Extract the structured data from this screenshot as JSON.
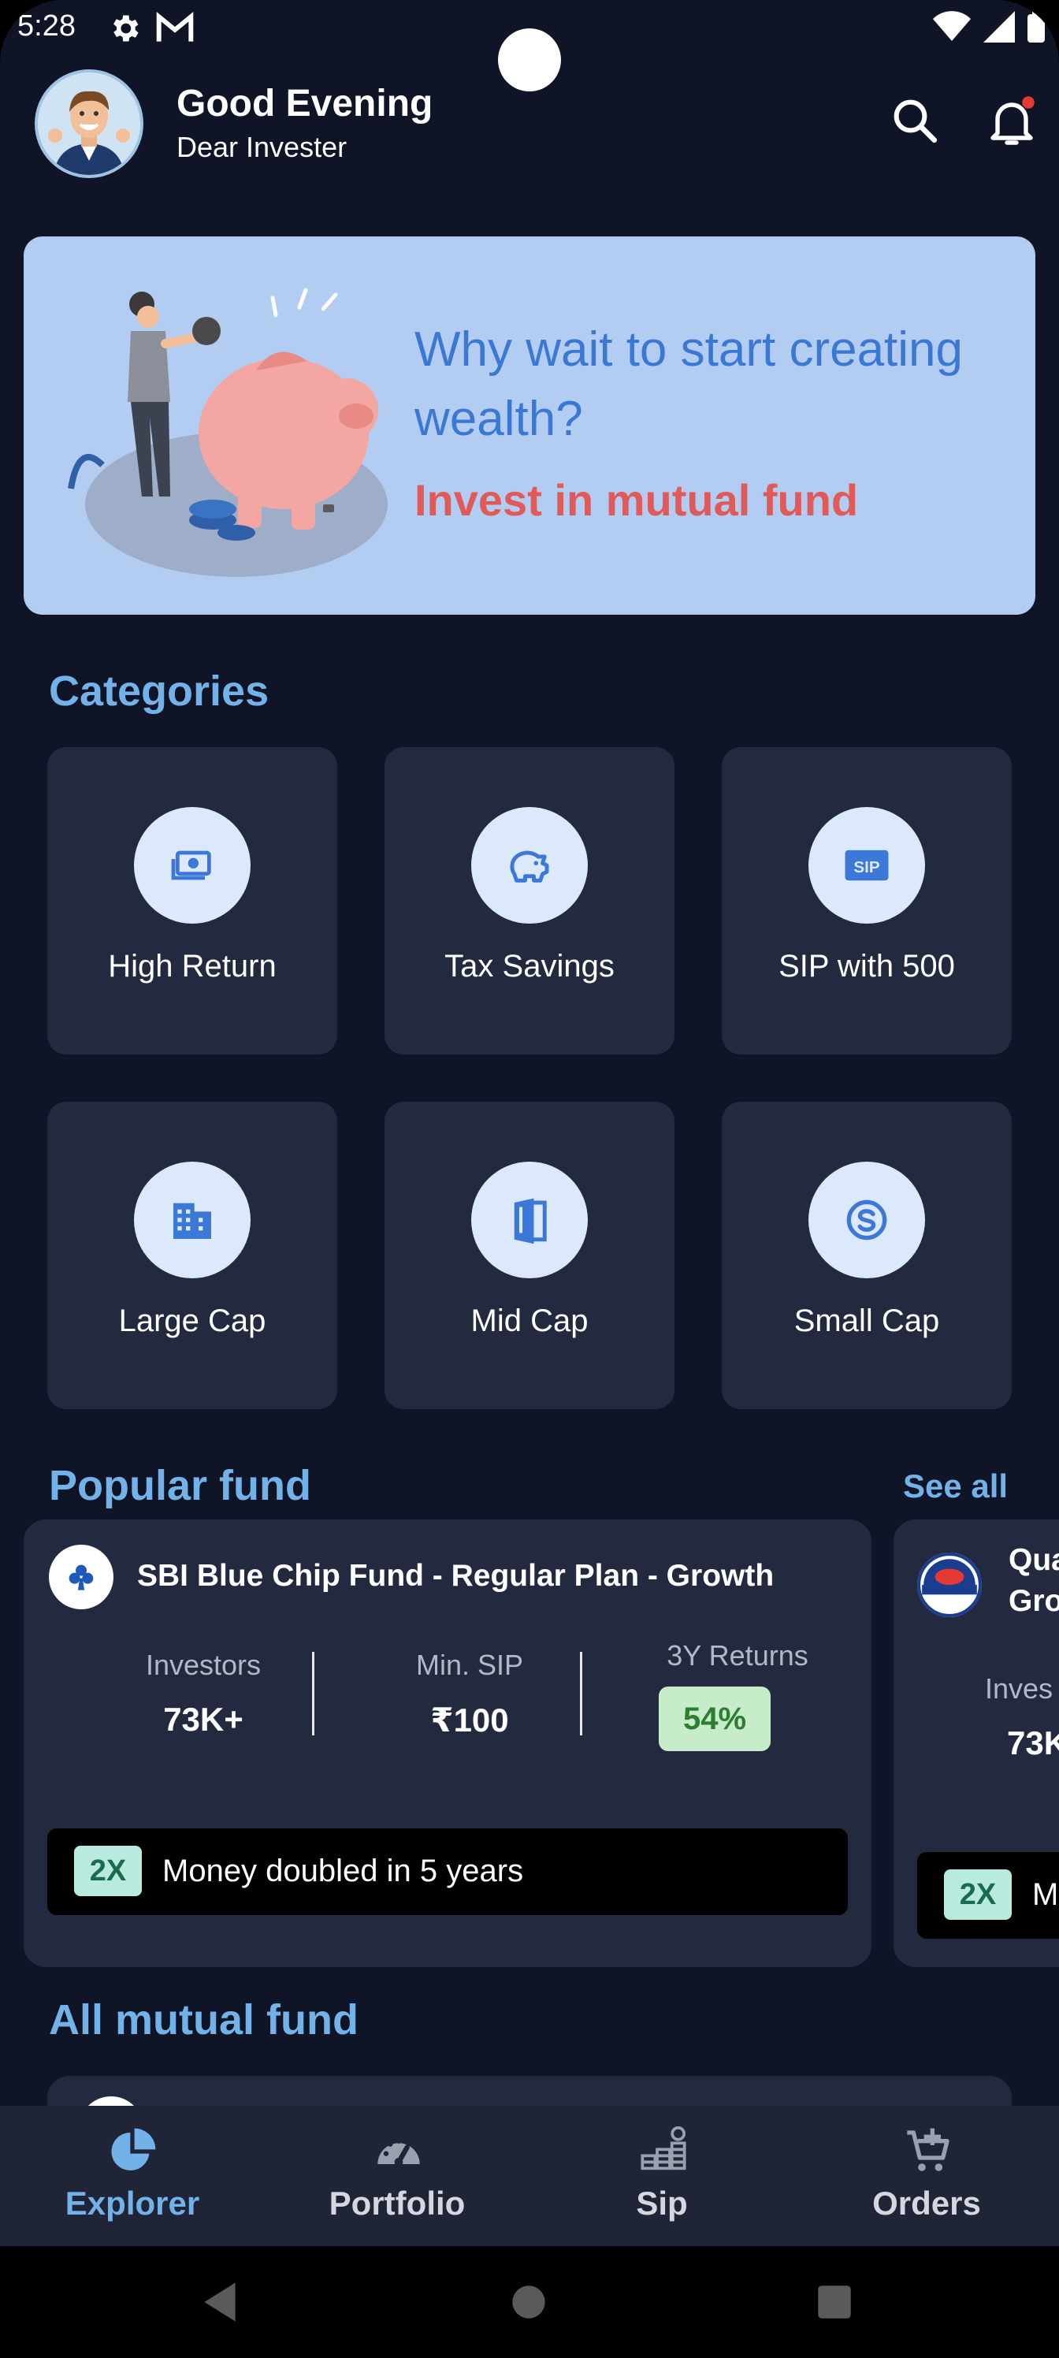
{
  "status_bar": {
    "time": "5:28"
  },
  "header": {
    "greeting": "Good Evening",
    "subgreeting": "Dear Invester"
  },
  "banner": {
    "title": "Why wait to start creating wealth?",
    "subtitle": "Invest in mutual fund"
  },
  "categories": {
    "title": "Categories",
    "items": [
      {
        "label": "High Return",
        "icon": "money-icon"
      },
      {
        "label": "Tax Savings",
        "icon": "piggy-bank-icon"
      },
      {
        "label": "SIP with 500",
        "icon": "sip-icon"
      },
      {
        "label": "Large Cap",
        "icon": "building-icon"
      },
      {
        "label": "Mid Cap",
        "icon": "door-icon"
      },
      {
        "label": "Small Cap",
        "icon": "skype-icon"
      }
    ]
  },
  "popular_fund": {
    "title": "Popular fund",
    "see_all": "See all",
    "funds": [
      {
        "name": "SBI Blue Chip Fund - Regular Plan - Growth",
        "investors_label": "Investors",
        "investors": "73K+",
        "min_sip_label": "Min. SIP",
        "min_sip": "₹100",
        "returns_label": "3Y Returns",
        "returns": "54%",
        "badge": "2X",
        "badge_text": "Money doubled in 5 years"
      },
      {
        "name_line1": "Qua",
        "name_line2": "Gro",
        "investors_label": "Inves",
        "investors": "73K",
        "badge": "2X",
        "badge_text": "M"
      }
    ]
  },
  "all_mutual_fund": {
    "title": "All mutual fund"
  },
  "bottom_nav": {
    "items": [
      {
        "label": "Explorer",
        "active": true
      },
      {
        "label": "Portfolio",
        "active": false
      },
      {
        "label": "Sip",
        "active": false
      },
      {
        "label": "Orders",
        "active": false
      }
    ]
  },
  "colors": {
    "background": "#0f1426",
    "card": "#232a40",
    "accent": "#72b2e8",
    "banner": "#b3cdf2",
    "banner_title": "#3a78d4",
    "banner_subtitle": "#e05a5a",
    "returns_badge": "#c6ecc9",
    "notification_dot": "#e53935"
  }
}
